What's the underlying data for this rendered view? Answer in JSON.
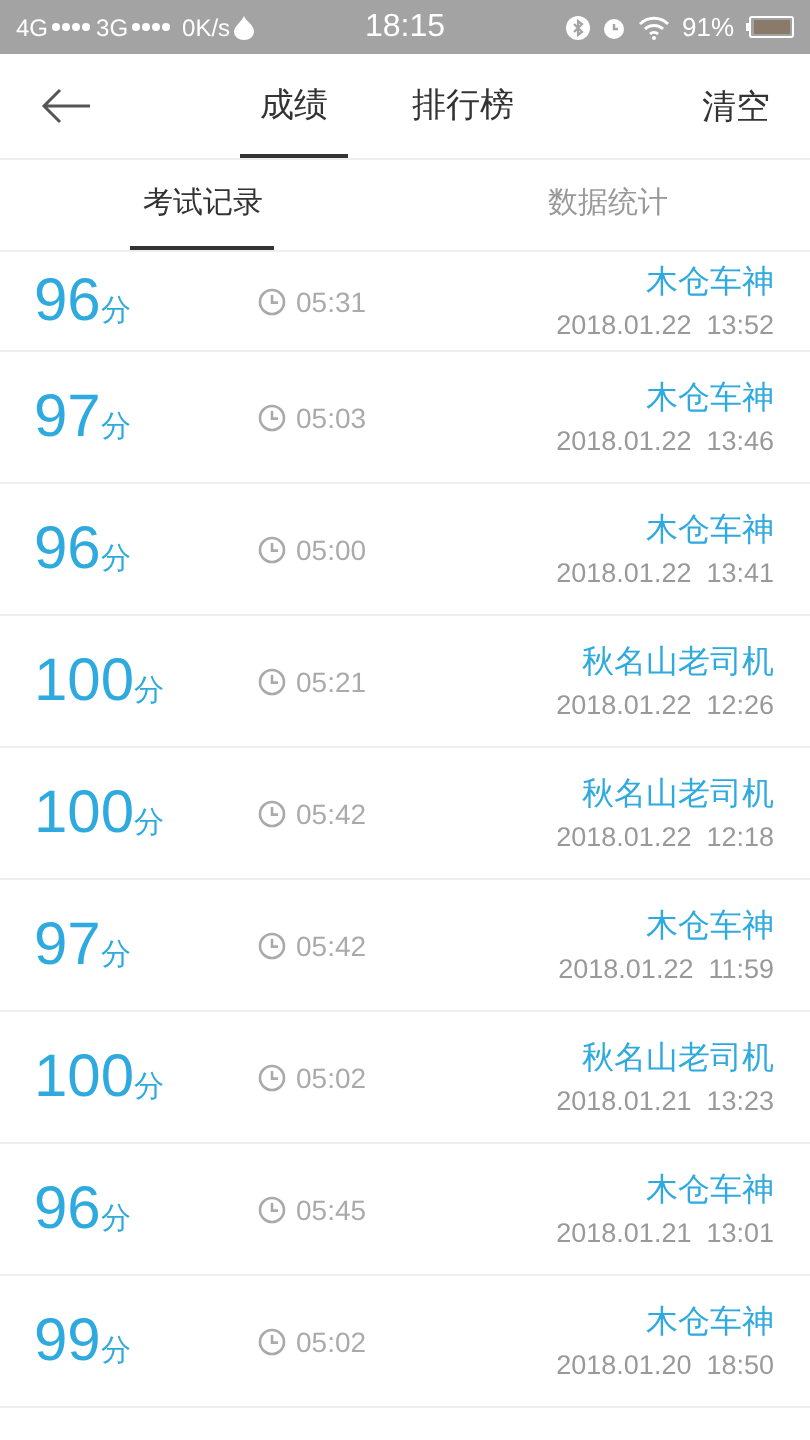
{
  "status_bar": {
    "network_1": "4G",
    "network_2": "3G",
    "speed": "0K/s",
    "time": "18:15",
    "battery": "91%"
  },
  "header": {
    "tabs": [
      {
        "label": "成绩",
        "selected": true
      },
      {
        "label": "排行榜",
        "selected": false
      }
    ],
    "action": "清空"
  },
  "subtabs": [
    {
      "label": "考试记录",
      "selected": true
    },
    {
      "label": "数据统计",
      "selected": false
    }
  ],
  "records": [
    {
      "score": "96",
      "unit": "分",
      "duration": "05:31",
      "name": "木仓车神",
      "date": "2018.01.22  13:52"
    },
    {
      "score": "97",
      "unit": "分",
      "duration": "05:03",
      "name": "木仓车神",
      "date": "2018.01.22  13:46"
    },
    {
      "score": "96",
      "unit": "分",
      "duration": "05:00",
      "name": "木仓车神",
      "date": "2018.01.22  13:41"
    },
    {
      "score": "100",
      "unit": "分",
      "duration": "05:21",
      "name": "秋名山老司机",
      "date": "2018.01.22  12:26"
    },
    {
      "score": "100",
      "unit": "分",
      "duration": "05:42",
      "name": "秋名山老司机",
      "date": "2018.01.22  12:18"
    },
    {
      "score": "97",
      "unit": "分",
      "duration": "05:42",
      "name": "木仓车神",
      "date": "2018.01.22  11:59"
    },
    {
      "score": "100",
      "unit": "分",
      "duration": "05:02",
      "name": "秋名山老司机",
      "date": "2018.01.21  13:23"
    },
    {
      "score": "96",
      "unit": "分",
      "duration": "05:45",
      "name": "木仓车神",
      "date": "2018.01.21  13:01"
    },
    {
      "score": "99",
      "unit": "分",
      "duration": "05:02",
      "name": "木仓车神",
      "date": "2018.01.20  18:50"
    }
  ]
}
